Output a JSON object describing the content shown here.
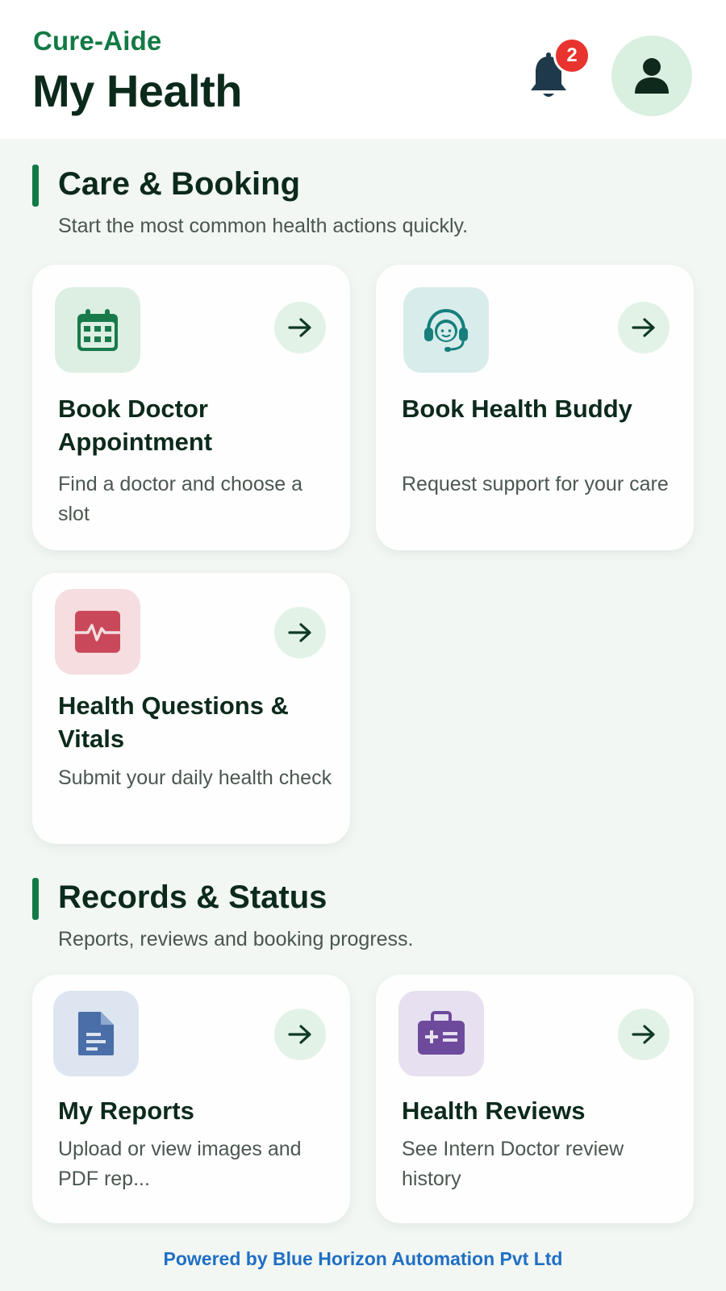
{
  "app": {
    "brand": "Cure-Aide",
    "page_title": "My Health",
    "notification_count": "2"
  },
  "sections": [
    {
      "title": "Care & Booking",
      "subtitle": "Start the most common health actions quickly.",
      "cards": [
        {
          "title": "Book Doctor Appointment",
          "desc": "Find a doctor and choose a slot",
          "icon": "calendar-icon",
          "tile_color": "#dcefe2",
          "icon_color": "#187a4a"
        },
        {
          "title": "Book Health Buddy",
          "desc": "Request support for your care",
          "icon": "headset-icon",
          "tile_color": "#d9ecec",
          "icon_color": "#167f7b"
        },
        {
          "title": "Health Questions & Vitals",
          "desc": "Submit your daily health check",
          "icon": "heart-pulse-icon",
          "tile_color": "#f5dde0",
          "icon_color": "#c9495a"
        }
      ]
    },
    {
      "title": "Records & Status",
      "subtitle": "Reports, reviews and booking progress.",
      "cards": [
        {
          "title": "My Reports",
          "desc": "Upload or view images and PDF rep...",
          "icon": "document-icon",
          "tile_color": "#dde5f1",
          "icon_color": "#4a6fa8"
        },
        {
          "title": "Health Reviews",
          "desc": "See Intern Doctor review history",
          "icon": "medical-kit-icon",
          "tile_color": "#e6e0f0",
          "icon_color": "#6e4a9c"
        }
      ]
    }
  ],
  "footer": {
    "text": "Powered by Blue Horizon Automation Pvt Ltd"
  }
}
